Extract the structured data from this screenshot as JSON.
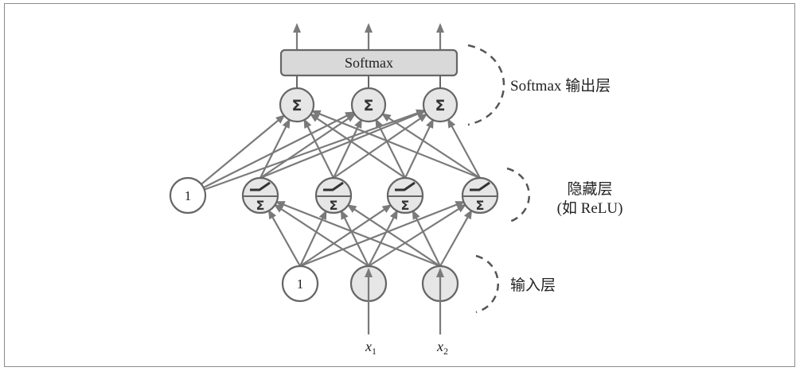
{
  "output_layer": {
    "softmax_label": "Softmax",
    "neurons": [
      {
        "symbol": "Σ"
      },
      {
        "symbol": "Σ"
      },
      {
        "symbol": "Σ"
      }
    ]
  },
  "hidden_layer": {
    "bias_label": "1",
    "neurons": [
      {
        "symbol": "Σ",
        "activation_icon": "relu-icon"
      },
      {
        "symbol": "Σ",
        "activation_icon": "relu-icon"
      },
      {
        "symbol": "Σ",
        "activation_icon": "relu-icon"
      },
      {
        "symbol": "Σ",
        "activation_icon": "relu-icon"
      }
    ]
  },
  "input_layer": {
    "bias_label": "1",
    "inputs": [
      {
        "var": "x",
        "sub": "1"
      },
      {
        "var": "x",
        "sub": "2"
      }
    ]
  },
  "annotations": {
    "output_layer": "Softmax 输出层",
    "hidden_layer": "隐藏层",
    "hidden_layer_note": "(如 ReLU)",
    "input_layer": "输入层"
  },
  "colors": {
    "edge": "#7a7a7a",
    "node_stroke": "#666666",
    "node_fill": "#e6e6e6",
    "bias_fill": "#ffffff",
    "softmax_fill": "#d9d9d9",
    "bracket": "#555555",
    "text": "#222222"
  }
}
